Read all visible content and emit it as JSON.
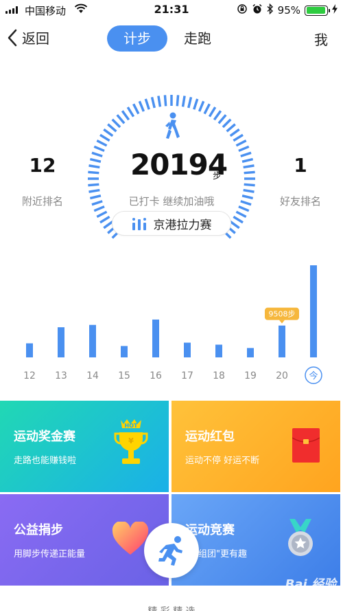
{
  "status_bar": {
    "carrier": "中国移动",
    "time": "21:31",
    "battery": "95%",
    "battery_level": 0.95
  },
  "nav": {
    "back_label": "返回",
    "tabs": [
      {
        "label": "计步"
      },
      {
        "label": "走跑"
      }
    ],
    "me_label": "我"
  },
  "hero": {
    "steps": "20194",
    "unit": "步",
    "checkin_text": "已打卡  继续加油哦",
    "nearby_rank": "12",
    "nearby_label": "附近排名",
    "friend_rank": "1",
    "friend_label": "好友排名",
    "race_label": "京港拉力赛",
    "gauge_color": "#4a90f0"
  },
  "chart_data": {
    "type": "bar",
    "categories": [
      "12",
      "13",
      "14",
      "15",
      "16",
      "17",
      "18",
      "19",
      "20",
      "今"
    ],
    "values": [
      4200,
      9000,
      9700,
      3400,
      11300,
      4400,
      3800,
      2800,
      9508,
      27500
    ],
    "annotation": "9508步",
    "annotation_index": 8,
    "bar_color": "#4a90f0",
    "today_label": "今"
  },
  "cards": [
    {
      "title": "运动奖金赛",
      "subtitle": "走路也能赚钱啦",
      "icon": "trophy-icon",
      "hot": "HOT"
    },
    {
      "title": "运动红包",
      "subtitle": "运动不停 好运不断",
      "icon": "red-envelope-icon"
    },
    {
      "title": "公益捐步",
      "subtitle": "用脚步传递正能量",
      "icon": "heart-icon"
    },
    {
      "title": "运动竞赛",
      "subtitle": "动\"组团\"更有趣",
      "icon": "medal-icon"
    }
  ],
  "footer": {
    "text": "精 彩 精 选"
  },
  "watermark": "Bai 经验"
}
